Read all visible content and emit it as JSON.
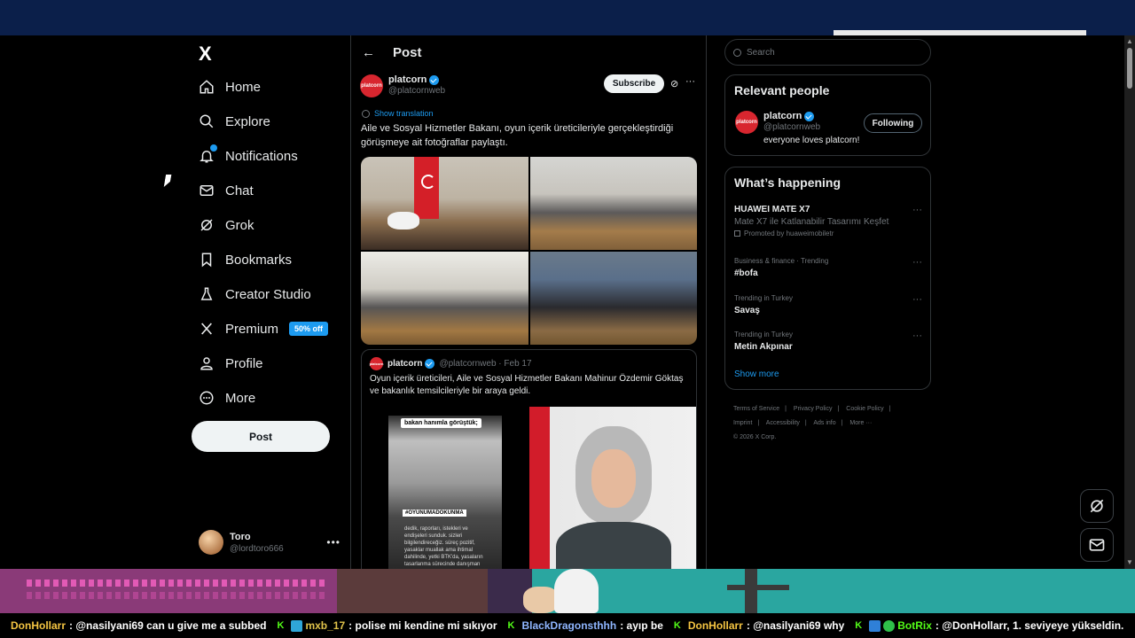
{
  "nav": {
    "logo": "X",
    "items": [
      {
        "label": "Home",
        "icon": "home-icon"
      },
      {
        "label": "Explore",
        "icon": "search-icon"
      },
      {
        "label": "Notifications",
        "icon": "bell-icon"
      },
      {
        "label": "Chat",
        "icon": "mail-icon"
      },
      {
        "label": "Grok",
        "icon": "grok-icon"
      },
      {
        "label": "Bookmarks",
        "icon": "bookmark-icon"
      },
      {
        "label": "Creator Studio",
        "icon": "flask-icon"
      },
      {
        "label": "Premium",
        "icon": "x-icon"
      },
      {
        "label": "Profile",
        "icon": "person-icon"
      },
      {
        "label": "More",
        "icon": "more-circle-icon"
      }
    ],
    "premium_badge": "50% off",
    "post_label": "Post",
    "account": {
      "name": "Toro",
      "handle": "@lordtoro666"
    }
  },
  "post": {
    "header_title": "Post",
    "author_name": "platcorn",
    "author_handle": "@platcornweb",
    "avatar_text": "platcorn",
    "subscribe_label": "Subscribe",
    "show_translation": "Show translation",
    "text": "Aile ve Sosyal Hizmetler Bakanı, oyun içerik üreticileriyle gerçekleştirdiği görüşmeye ait fotoğraflar paylaştı.",
    "quote": {
      "author_name": "platcorn",
      "meta": "@platcornweb · Feb 17",
      "text": "Oyun içerik üreticileri, Aile ve Sosyal Hizmetler Bakanı Mahinur Özdemir Göktaş ve bakanlık temsilcileriyle bir araya geldi.",
      "image_caption": "bakan hanımla görüştük;",
      "image_tag": "#OYUNUMADOKUNMA",
      "image_note": "dedik, raporları, istekleri ve endişeleri sunduk. sizleri bilgilendireceğiz. süreç pozitif, yasaklar muallak ama ihtimal dahilinde, yetki BTK'da, yasaların tasarlanma sürecinde danışman heyeti istiyoruz dedik. biz ses"
    }
  },
  "right": {
    "search_placeholder": "Search",
    "relevant_title": "Relevant people",
    "person": {
      "name": "platcorn",
      "handle": "@platcornweb",
      "bio": "everyone loves platcorn!",
      "follow_label": "Following"
    },
    "happening_title": "What’s happening",
    "trends": [
      {
        "name": "HUAWEI MATE X7",
        "sub": "Mate X7 ile Katlanabilir Tasarımı Keşfet",
        "promo": "Promoted by huaweimobiletr"
      },
      {
        "category": "Business & finance · Trending",
        "name": "#bofa"
      },
      {
        "category": "Trending in Turkey",
        "name": "Savaş"
      },
      {
        "category": "Trending in Turkey",
        "name": "Metin Akpınar"
      }
    ],
    "show_more": "Show more",
    "footer": [
      "Terms of Service",
      "|",
      "Privacy Policy",
      "|",
      "Cookie Policy",
      "|",
      "Imprint",
      "|",
      "Accessibility",
      "|",
      "Ads info",
      "|",
      "More ···",
      "© 2026 X Corp."
    ]
  },
  "chat": [
    {
      "user": "DonHollarr",
      "color": "#f5c542",
      "text": "@nasilyani69 can u give me a subbed"
    },
    {
      "user": "mxb_17",
      "color": "#e0c34b",
      "text": "polise mi kendine mi sıkıyor"
    },
    {
      "user": "BlackDragonsthhh",
      "color": "#8fb6ff",
      "text": "ayıp be"
    },
    {
      "user": "DonHollarr",
      "color": "#f5c542",
      "text": "@nasilyani69 why"
    },
    {
      "user": "BotRix",
      "color": "#53fc18",
      "text": "@DonHollarr, 1. seviyeye yükseldin."
    }
  ]
}
